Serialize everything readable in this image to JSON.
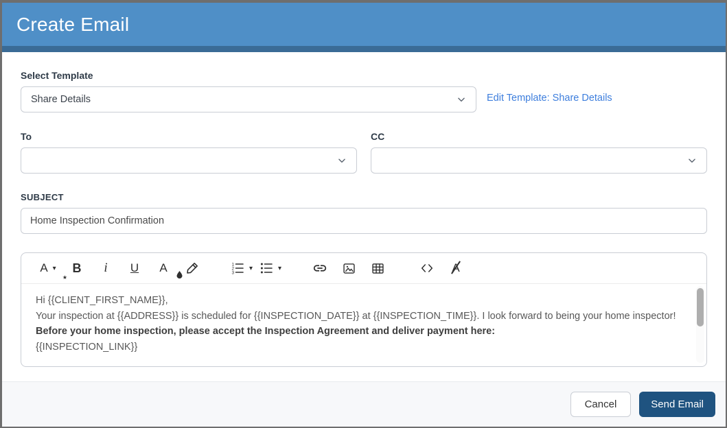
{
  "window": {
    "title": "Create Email"
  },
  "colors": {
    "header_bg": "#4f8fc7",
    "header_strip": "#3a6b96",
    "link_blue": "#3d7edd",
    "send_bg": "#1f5380",
    "label_color": "#2e3a47",
    "border": "#c9cdd4",
    "footer_bg": "#f7f8fa"
  },
  "template_section": {
    "label": "Select Template",
    "selected": "Share Details",
    "edit_link": "Edit Template: Share Details"
  },
  "recipients": {
    "to_label": "To",
    "to_value": "",
    "cc_label": "CC",
    "cc_value": ""
  },
  "subject": {
    "label": "SUBJECT",
    "value": "Home Inspection Confirmation"
  },
  "editor": {
    "toolbar": {
      "font_style_glyph": "A",
      "star_glyph": "★",
      "bold_glyph": "B",
      "italic_glyph": "i",
      "underline_glyph": "U",
      "font_color_glyph": "A",
      "clear_format_glyph": "A",
      "caret_glyph": "▾",
      "icon_names": [
        "font-style",
        "bold",
        "italic",
        "underline",
        "font-color",
        "highlight",
        "ordered-list",
        "unordered-list",
        "link",
        "image",
        "table",
        "code",
        "clear-format"
      ]
    },
    "body_lines": [
      {
        "text": "Hi {{CLIENT_FIRST_NAME}},",
        "bold": false
      },
      {
        "text": "Your inspection at {{ADDRESS}} is scheduled for {{INSPECTION_DATE}} at {{INSPECTION_TIME}}. I look forward to being your home inspector!",
        "bold": false
      },
      {
        "text": "Before your home inspection, please accept the Inspection Agreement and deliver payment here:",
        "bold": true
      },
      {
        "text": "{{INSPECTION_LINK}}",
        "bold": false
      }
    ]
  },
  "footer": {
    "cancel_label": "Cancel",
    "send_label": "Send Email"
  }
}
